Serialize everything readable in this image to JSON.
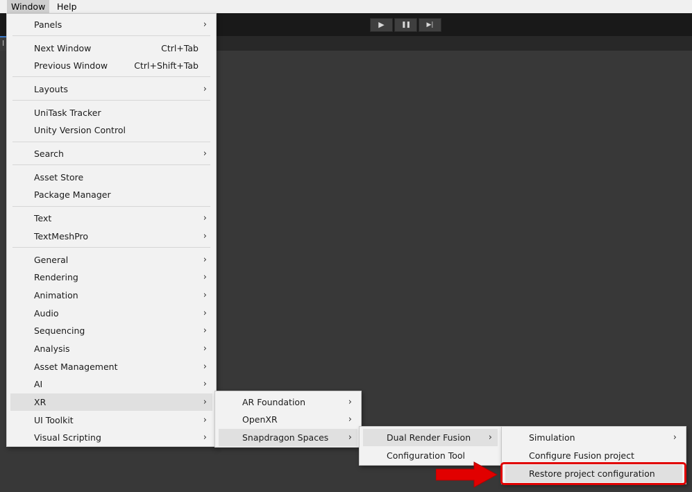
{
  "menubar": {
    "items": [
      "Window",
      "Help"
    ]
  },
  "toolbar": {
    "play_icon": "▶",
    "pause_icon": "❚❚",
    "step_icon": "▶|",
    "tab_letter": "I"
  },
  "window_menu": {
    "items": [
      {
        "label": "Panels",
        "submenu": true
      },
      {
        "label": "Next Window",
        "shortcut": "Ctrl+Tab"
      },
      {
        "label": "Previous Window",
        "shortcut": "Ctrl+Shift+Tab"
      },
      {
        "label": "Layouts",
        "submenu": true
      },
      {
        "label": "UniTask Tracker"
      },
      {
        "label": "Unity Version Control"
      },
      {
        "label": "Search",
        "submenu": true
      },
      {
        "label": "Asset Store"
      },
      {
        "label": "Package Manager"
      },
      {
        "label": "Text",
        "submenu": true
      },
      {
        "label": "TextMeshPro",
        "submenu": true
      },
      {
        "label": "General",
        "submenu": true
      },
      {
        "label": "Rendering",
        "submenu": true
      },
      {
        "label": "Animation",
        "submenu": true
      },
      {
        "label": "Audio",
        "submenu": true
      },
      {
        "label": "Sequencing",
        "submenu": true
      },
      {
        "label": "Analysis",
        "submenu": true
      },
      {
        "label": "Asset Management",
        "submenu": true
      },
      {
        "label": "AI",
        "submenu": true
      },
      {
        "label": "XR",
        "submenu": true,
        "highlighted": true
      },
      {
        "label": "UI Toolkit",
        "submenu": true
      },
      {
        "label": "Visual Scripting",
        "submenu": true
      }
    ]
  },
  "xr_menu": {
    "items": [
      {
        "label": "AR Foundation",
        "submenu": true
      },
      {
        "label": "OpenXR",
        "submenu": true
      },
      {
        "label": "Snapdragon Spaces",
        "submenu": true,
        "highlighted": true
      }
    ]
  },
  "spaces_menu": {
    "items": [
      {
        "label": "Dual Render Fusion",
        "submenu": true,
        "highlighted": true
      },
      {
        "label": "Configuration Tool"
      }
    ]
  },
  "fusion_menu": {
    "items": [
      {
        "label": "Simulation",
        "submenu": true
      },
      {
        "label": "Configure Fusion project"
      },
      {
        "label": "Restore project configuration",
        "highlighted": true
      }
    ]
  },
  "icons": {
    "chevron": "chevron-right-icon",
    "arrow": "red-arrow-icon"
  },
  "colors": {
    "annotation": "#e10000",
    "menu_bg": "#f2f2f2",
    "highlight": "#e0e0e0"
  }
}
